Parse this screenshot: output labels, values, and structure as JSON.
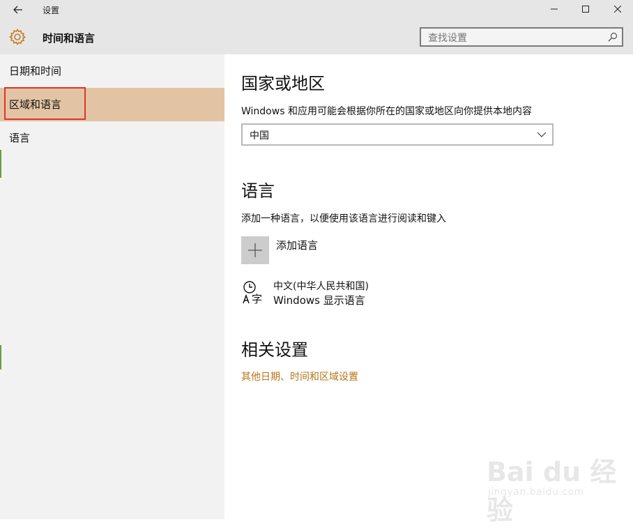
{
  "window": {
    "title": "设置",
    "back_icon": "back-arrow-icon",
    "controls": [
      "minimize",
      "maximize",
      "close"
    ]
  },
  "header": {
    "title": "时间和语言",
    "icon": "gear-icon",
    "search_placeholder": "查找设置"
  },
  "sidebar": {
    "items": [
      {
        "label": "日期和时间",
        "active": false
      },
      {
        "label": "区域和语言",
        "active": true
      },
      {
        "label": "语言",
        "active": false
      }
    ]
  },
  "main": {
    "region": {
      "heading": "国家或地区",
      "description": "Windows 和应用可能会根据你所在的国家或地区向你提供本地内容",
      "selected": "中国"
    },
    "language": {
      "heading": "语言",
      "description": "添加一种语言，以便使用该语言进行阅读和键入",
      "add_label": "添加语言",
      "installed": [
        {
          "name": "中文(中华人民共和国)",
          "status": "Windows 显示语言"
        }
      ]
    },
    "related": {
      "heading": "相关设置",
      "link": "其他日期、时间和区域设置"
    }
  },
  "watermark": {
    "logo": "Bai du 经验",
    "url": "jingyan.baidu.com"
  },
  "colors": {
    "accent": "#b8741a",
    "active_item": "#e2c4a4",
    "highlight_box": "#e0322e"
  }
}
